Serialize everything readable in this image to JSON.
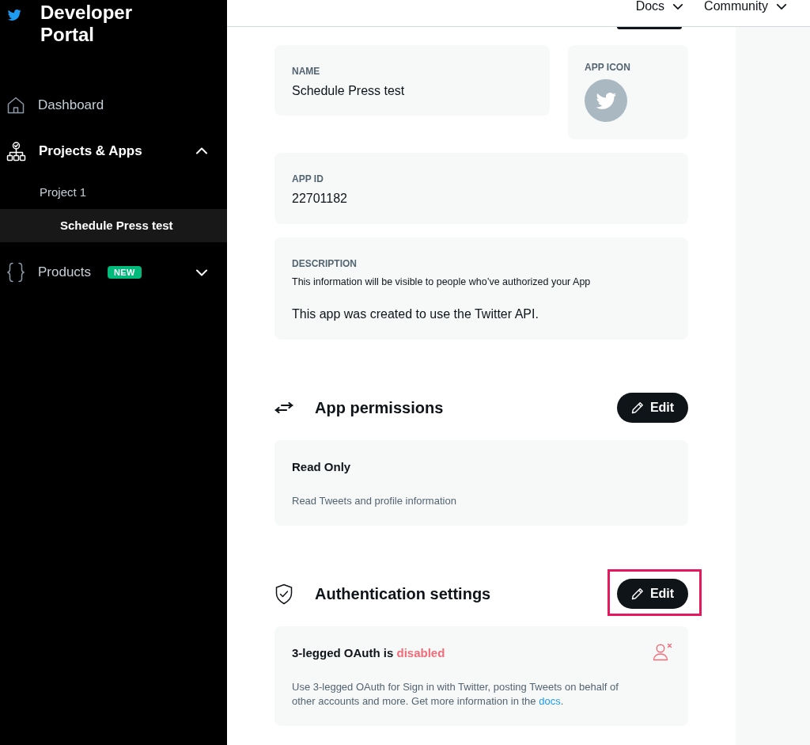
{
  "header": {
    "links": [
      {
        "label": "Docs"
      },
      {
        "label": "Community"
      }
    ]
  },
  "sidebar": {
    "title": "Developer Portal",
    "items": [
      {
        "label": "Dashboard",
        "kind": "link",
        "selected": false
      },
      {
        "label": "Projects & Apps",
        "kind": "group",
        "selected": true,
        "expanded": true,
        "children": [
          {
            "label": "Project 1",
            "selected": false,
            "children": [
              {
                "label": "Schedule Press test",
                "selected": true
              }
            ]
          }
        ]
      },
      {
        "label": "Products",
        "kind": "group",
        "selected": false,
        "expanded": false,
        "badge": "NEW"
      }
    ]
  },
  "app": {
    "name": {
      "label": "NAME",
      "value": "Schedule Press test"
    },
    "icon": {
      "label": "APP ICON"
    },
    "id": {
      "label": "APP ID",
      "value": "22701182"
    },
    "description": {
      "label": "DESCRIPTION",
      "hint": "This information will be visible to people who’ve authorized your App",
      "value": "This app was created to use the Twitter API."
    }
  },
  "sections": [
    {
      "kind": "permissions",
      "title": "App permissions",
      "button": "Edit",
      "highlighted": false,
      "card": {
        "title": "Read Only",
        "text": "Read Tweets and profile information"
      }
    },
    {
      "kind": "authentication",
      "title": "Authentication settings",
      "button": "Edit",
      "highlighted": true,
      "card": {
        "title": "3-legged OAuth is",
        "status": "disabled",
        "text": "Use 3-legged OAuth for Sign in with Twitter, posting Tweets on behalf of other accounts and more. Get more information in the",
        "link": "docs",
        "text_end": "."
      }
    }
  ]
}
